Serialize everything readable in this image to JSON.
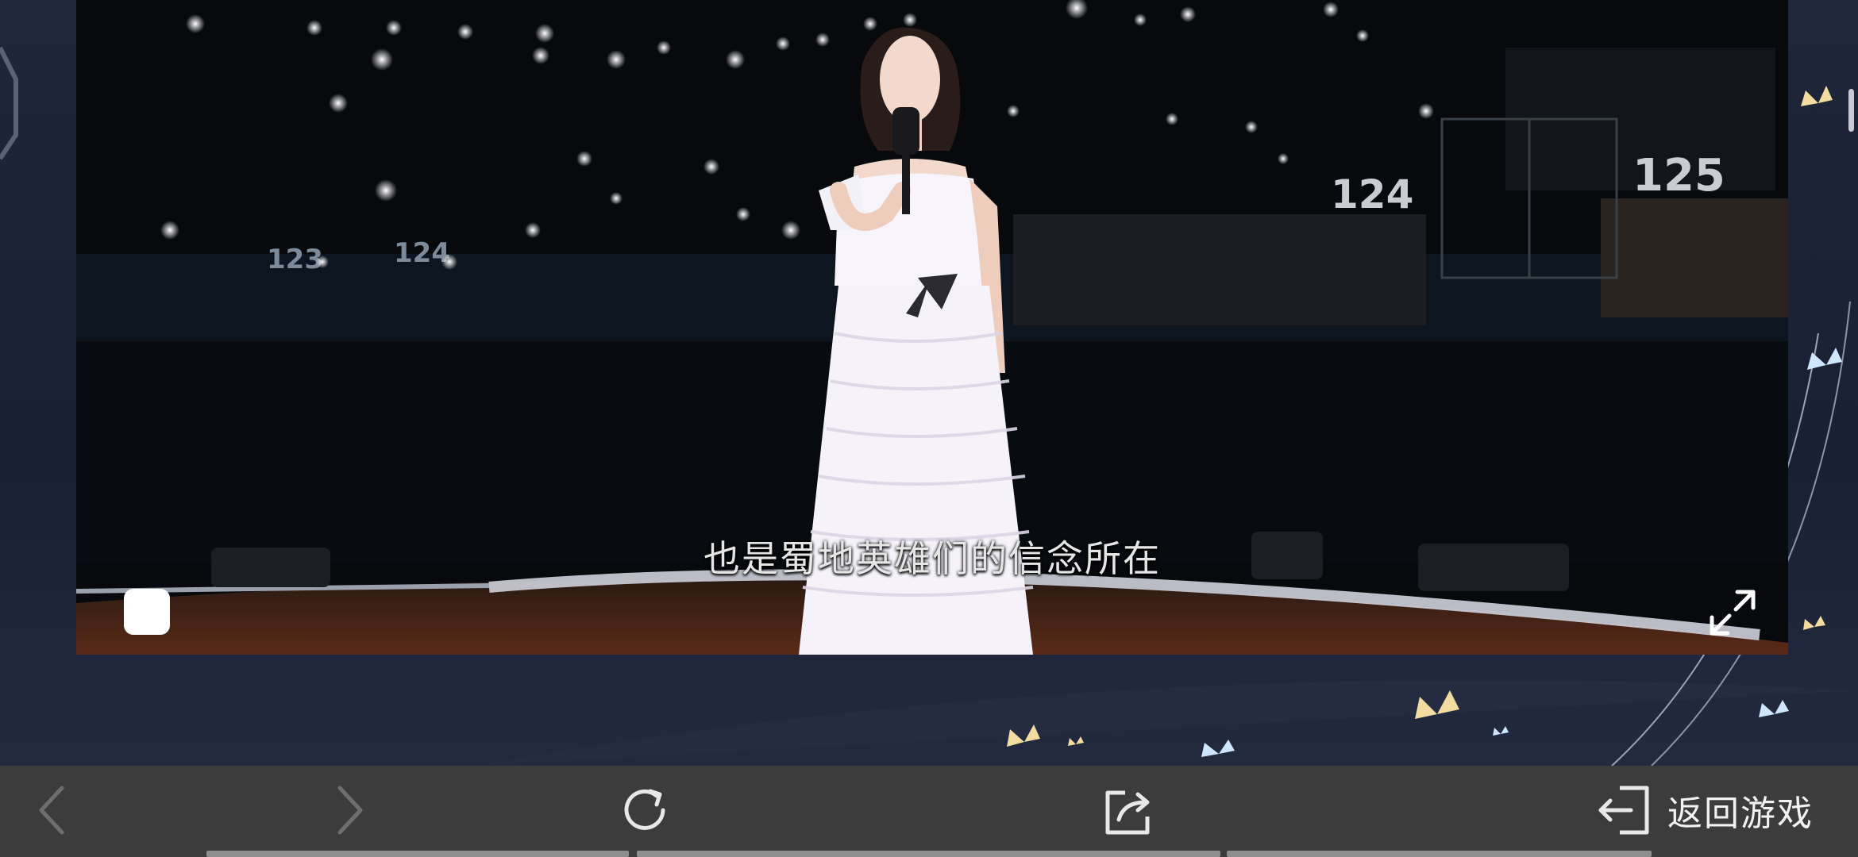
{
  "video": {
    "subtitle": "也是蜀地英雄们的信念所在",
    "seat_sections": [
      "123",
      "124",
      "124",
      "125"
    ],
    "controls": {
      "stop_icon": "stop-icon",
      "fullscreen_icon": "fullscreen-expand-icon"
    }
  },
  "toolbar": {
    "back_icon": "chevron-left-icon",
    "forward_icon": "chevron-right-icon",
    "refresh_icon": "refresh-icon",
    "share_icon": "share-icon",
    "return_game_icon": "exit-arrow-icon",
    "return_game_label": "返回游戏"
  },
  "colors": {
    "toolbar_bg": "#3c3c3c",
    "page_bg": "#1c2233",
    "disabled_icon": "#6e6e6e",
    "enabled_icon": "#e8e8e8"
  }
}
